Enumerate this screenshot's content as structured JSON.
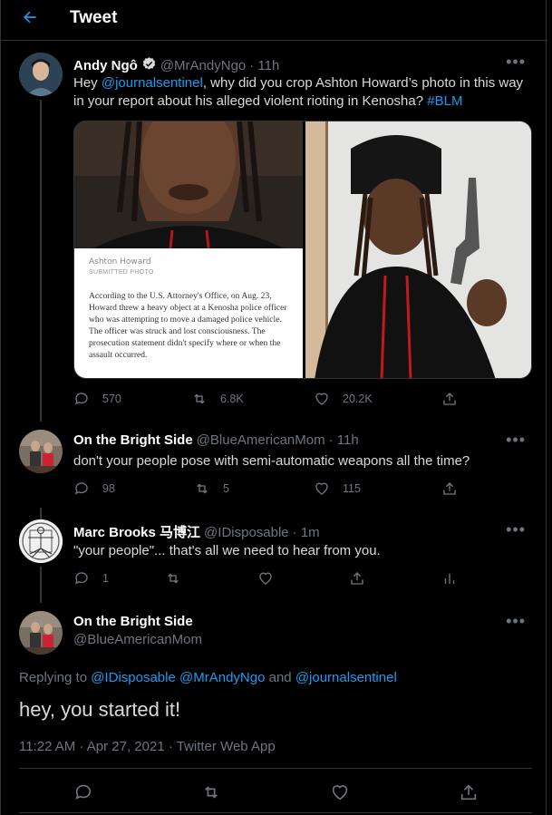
{
  "header": {
    "back_icon": "arrow-left-icon",
    "title": "Tweet"
  },
  "tweet1": {
    "name": "Andy Ngô",
    "verified": true,
    "handle": "@MrAndyNgo",
    "time": "· 11h",
    "text_prefix": "Hey ",
    "mention": "@journalsentinel",
    "text_middle": ", why did you crop Ashton Howard’s photo in this way",
    "text_line2": "in your report about his alleged violent rioting in Kenosha? ",
    "hashtag": "#BLM",
    "media_caption_name": "Ashton Howard",
    "media_caption_sub": "SUBMITTED PHOTO",
    "media_caption_body": "According to the U.S. Attorney's Office, on Aug. 23, Howard threw a heavy object at a Kenosha police officer who was attempting to move a damaged police vehicle. The officer was struck and lost consciousness. The prosecution statement didn't specify where or when the assault occurred.",
    "replies": "570",
    "retweets": "6.8K",
    "likes": "20.2K"
  },
  "tweet2": {
    "name": "On the Bright Side",
    "handle": "@BlueAmericanMom",
    "time": "· 11h",
    "text": "don't your people pose with semi-automatic weapons all the time?",
    "replies": "98",
    "retweets": "5",
    "likes": "115"
  },
  "tweet3": {
    "name": "Marc Brooks 马博江",
    "handle": "@IDisposable",
    "time": "· 1m",
    "text": "\"your people\"... that's all we need to hear from you.",
    "replies": "1"
  },
  "main_tweet": {
    "name": "On the Bright Side",
    "handle": "@BlueAmericanMom",
    "replying_label": "Replying to ",
    "reply_to_1": "@IDisposable",
    "reply_to_2": "@MrAndyNgo",
    "and_label": " and ",
    "reply_to_3": "@journalsentinel",
    "text": "hey, you started it!",
    "timestamp": "11:22 AM · Apr 27, 2021 · Twitter Web App"
  },
  "colors": {
    "accent": "#1d9bf0",
    "background": "#000000",
    "muted": "#6e767d",
    "border": "#2f3336"
  }
}
